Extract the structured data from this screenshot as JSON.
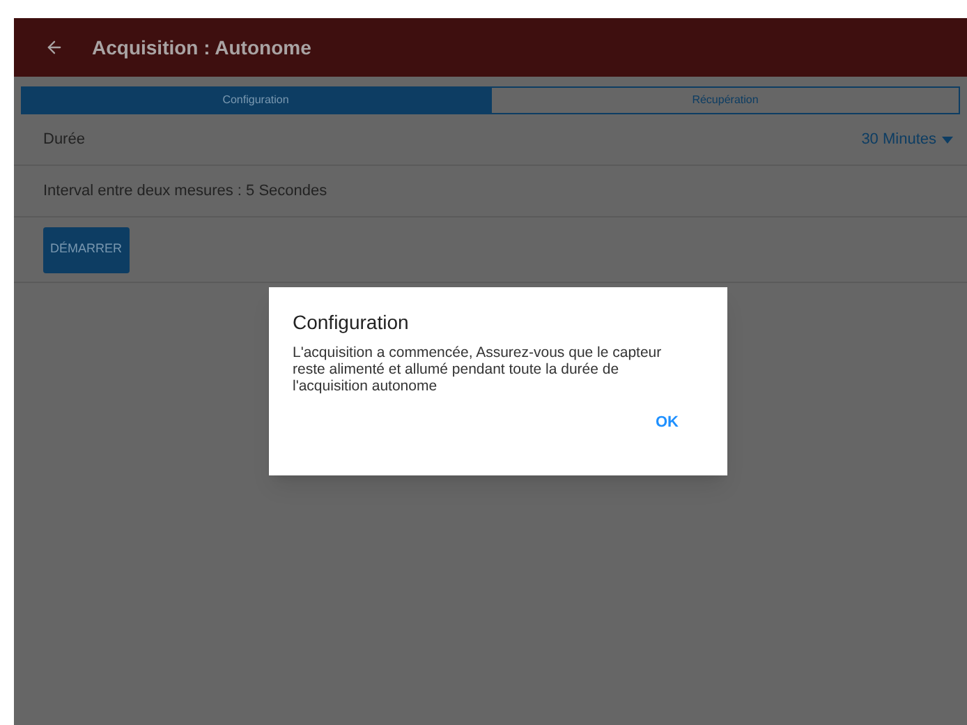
{
  "app_bar": {
    "title": "Acquisition : Autonome"
  },
  "tabs": [
    {
      "label": "Configuration",
      "selected": true
    },
    {
      "label": "Récupération",
      "selected": false
    }
  ],
  "duration": {
    "label": "Durée",
    "value": "30 Minutes"
  },
  "interval": {
    "text": "Interval entre deux mesures : 5 Secondes"
  },
  "start_button": {
    "label": "DÉMARRER"
  },
  "dialog": {
    "title": "Configuration",
    "message": "L'acquisition a commencée, Assurez-vous que le capteur reste alimenté et allumé pendant toute la durée de l'acquisition autonome",
    "button": "OK"
  }
}
